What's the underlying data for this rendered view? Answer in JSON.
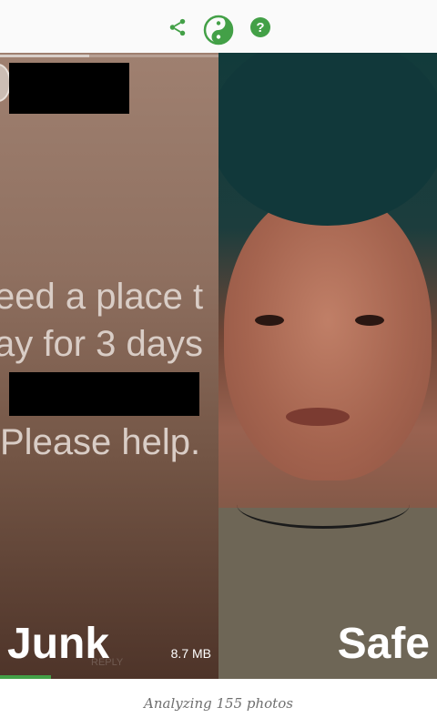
{
  "toolbar": {
    "icons": [
      "share-icon",
      "theme-toggle-icon",
      "help-icon"
    ],
    "accent_color": "#43a047"
  },
  "cards": {
    "junk": {
      "label": "Junk",
      "size": "8.7 MB",
      "text_lines": [
        "eed a place t",
        "ay for 3 days",
        "Please help."
      ],
      "faded_action": "REPLY"
    },
    "safe": {
      "label": "Safe"
    }
  },
  "status": {
    "text": "Analyzing 155 photos"
  }
}
